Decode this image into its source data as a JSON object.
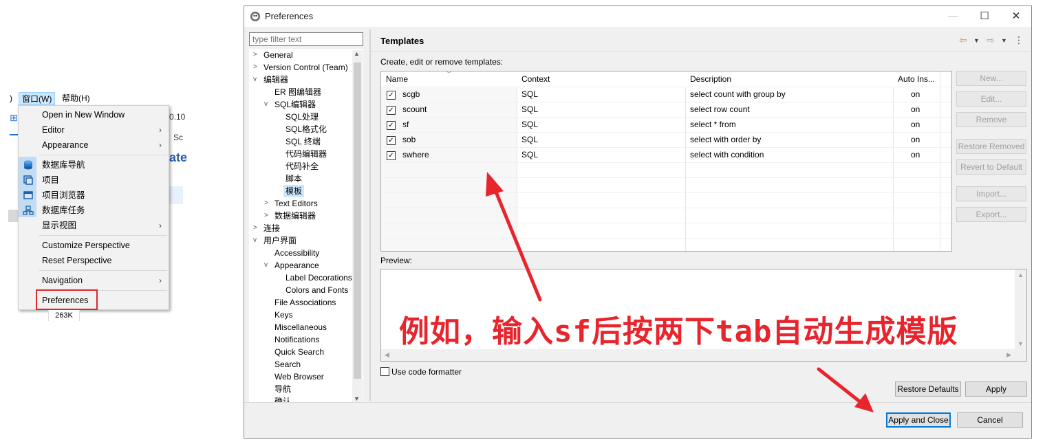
{
  "menubar": {
    "paren": ")",
    "window": "窗口(W)",
    "help": "帮助(H)"
  },
  "background": {
    "frag1": "0.10",
    "frag2": "Sc",
    "frag3": "ate",
    "size_label": "263K"
  },
  "window_menu": {
    "items": [
      {
        "label": "Open in New Window",
        "submenu": false
      },
      {
        "label": "Editor",
        "submenu": true
      },
      {
        "label": "Appearance",
        "submenu": true
      },
      {
        "label": "数据库导航",
        "submenu": false
      },
      {
        "label": "项目",
        "submenu": false
      },
      {
        "label": "项目浏览器",
        "submenu": false
      },
      {
        "label": "数据库任务",
        "submenu": false
      },
      {
        "label": "显示视图",
        "submenu": true
      },
      {
        "label": "Customize Perspective",
        "submenu": false
      },
      {
        "label": "Reset Perspective",
        "submenu": false
      },
      {
        "label": "Navigation",
        "submenu": true
      },
      {
        "label": "Preferences",
        "submenu": false
      }
    ],
    "arrow": "›"
  },
  "dialog": {
    "title": "Preferences",
    "filter_placeholder": "type filter text",
    "tree": [
      {
        "label": "General",
        "level": 0,
        "twisty": ">"
      },
      {
        "label": "Version Control (Team)",
        "level": 0,
        "twisty": ">"
      },
      {
        "label": "编辑器",
        "level": 0,
        "twisty": "v"
      },
      {
        "label": "ER 图编辑器",
        "level": 1,
        "twisty": ""
      },
      {
        "label": "SQL编辑器",
        "level": 1,
        "twisty": "v"
      },
      {
        "label": "SQL处理",
        "level": 2,
        "twisty": ""
      },
      {
        "label": "SQL格式化",
        "level": 2,
        "twisty": ""
      },
      {
        "label": "SQL 终端",
        "level": 2,
        "twisty": ""
      },
      {
        "label": "代码编辑器",
        "level": 2,
        "twisty": ""
      },
      {
        "label": "代码补全",
        "level": 2,
        "twisty": ""
      },
      {
        "label": "脚本",
        "level": 2,
        "twisty": ""
      },
      {
        "label": "模板",
        "level": 2,
        "twisty": "",
        "selected": true
      },
      {
        "label": "Text Editors",
        "level": 1,
        "twisty": ">"
      },
      {
        "label": "数据编辑器",
        "level": 1,
        "twisty": ">"
      },
      {
        "label": "连接",
        "level": 0,
        "twisty": ">"
      },
      {
        "label": "用户界面",
        "level": 0,
        "twisty": "v"
      },
      {
        "label": "Accessibility",
        "level": 1,
        "twisty": ""
      },
      {
        "label": "Appearance",
        "level": 1,
        "twisty": "v"
      },
      {
        "label": "Label Decorations",
        "level": 2,
        "twisty": ""
      },
      {
        "label": "Colors and Fonts",
        "level": 2,
        "twisty": ""
      },
      {
        "label": "File Associations",
        "level": 1,
        "twisty": ""
      },
      {
        "label": "Keys",
        "level": 1,
        "twisty": ""
      },
      {
        "label": "Miscellaneous",
        "level": 1,
        "twisty": ""
      },
      {
        "label": "Notifications",
        "level": 1,
        "twisty": ""
      },
      {
        "label": "Quick Search",
        "level": 1,
        "twisty": ""
      },
      {
        "label": "Search",
        "level": 1,
        "twisty": ""
      },
      {
        "label": "Web Browser",
        "level": 1,
        "twisty": ""
      },
      {
        "label": "导航",
        "level": 1,
        "twisty": ""
      },
      {
        "label": "确认",
        "level": 1,
        "twisty": ""
      }
    ],
    "page_title": "Templates",
    "create_label": "Create, edit or remove templates:",
    "columns": [
      "Name",
      "Context",
      "Description",
      "Auto Ins..."
    ],
    "templates": [
      {
        "name": "scgb",
        "context": "SQL",
        "description": "select count with group by",
        "auto": "on"
      },
      {
        "name": "scount",
        "context": "SQL",
        "description": "select row count",
        "auto": "on"
      },
      {
        "name": "sf",
        "context": "SQL",
        "description": "select * from",
        "auto": "on"
      },
      {
        "name": "sob",
        "context": "SQL",
        "description": "select with order by",
        "auto": "on"
      },
      {
        "name": "swhere",
        "context": "SQL",
        "description": "select with condition",
        "auto": "on"
      }
    ],
    "check_mark": "✓",
    "buttons": {
      "new": "New...",
      "edit": "Edit...",
      "remove": "Remove",
      "restore_removed": "Restore Removed",
      "revert": "Revert to Default",
      "import": "Import...",
      "export": "Export...",
      "restore_defaults": "Restore Defaults",
      "apply": "Apply",
      "apply_close": "Apply and Close",
      "cancel": "Cancel"
    },
    "preview_label": "Preview:",
    "use_formatter": "Use code formatter",
    "annotation": "例如，输入sf后按两下tab自动生成模版"
  },
  "colors": {
    "annotation_red": "#e8242c",
    "selection_blue": "#cce8ff",
    "default_button_border": "#0078d7"
  }
}
